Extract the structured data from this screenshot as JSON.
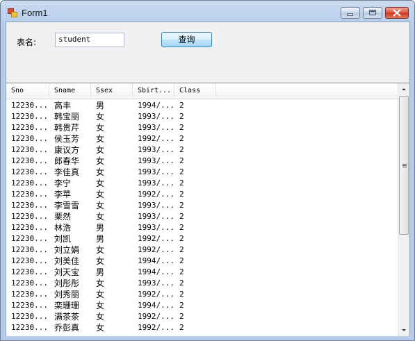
{
  "window": {
    "title": "Form1"
  },
  "form": {
    "table_label": "表名:",
    "table_input_value": "student",
    "query_button": "查询"
  },
  "grid": {
    "columns": [
      "Sno",
      "Sname",
      "Ssex",
      "Sbirt...",
      "Class"
    ],
    "rows": [
      [
        "12230...",
        "高丰",
        "男",
        "1994/...",
        "2"
      ],
      [
        "12230...",
        "韩宝丽",
        "女",
        "1993/...",
        "2"
      ],
      [
        "12230...",
        "韩贵芹",
        "女",
        "1993/...",
        "2"
      ],
      [
        "12230...",
        "侯玉芳",
        "女",
        "1992/...",
        "2"
      ],
      [
        "12230...",
        "康议方",
        "女",
        "1993/...",
        "2"
      ],
      [
        "12230...",
        "郎春华",
        "女",
        "1993/...",
        "2"
      ],
      [
        "12230...",
        "李佳真",
        "女",
        "1993/...",
        "2"
      ],
      [
        "12230...",
        "李宁",
        "女",
        "1993/...",
        "2"
      ],
      [
        "12230...",
        "李苹",
        "女",
        "1992/...",
        "2"
      ],
      [
        "12230...",
        "李雪雪",
        "女",
        "1993/...",
        "2"
      ],
      [
        "12230...",
        "栗然",
        "女",
        "1993/...",
        "2"
      ],
      [
        "12230...",
        "林浩",
        "男",
        "1993/...",
        "2"
      ],
      [
        "12230...",
        "刘凯",
        "男",
        "1992/...",
        "2"
      ],
      [
        "12230...",
        "刘立娟",
        "女",
        "1992/...",
        "2"
      ],
      [
        "12230...",
        "刘美佳",
        "女",
        "1994/...",
        "2"
      ],
      [
        "12230...",
        "刘天宝",
        "男",
        "1994/...",
        "2"
      ],
      [
        "12230...",
        "刘彤彤",
        "女",
        "1993/...",
        "2"
      ],
      [
        "12230...",
        "刘秀丽",
        "女",
        "1992/...",
        "2"
      ],
      [
        "12230...",
        "栾珊珊",
        "女",
        "1994/...",
        "2"
      ],
      [
        "12230...",
        "满茶茶",
        "女",
        "1992/...",
        "2"
      ],
      [
        "12230...",
        "乔彭真",
        "女",
        "1992/...",
        "2"
      ]
    ]
  },
  "icons": {
    "app": "form-app-icon",
    "minimize": "minimize-icon",
    "maximize": "maximize-icon",
    "close": "close-icon",
    "scroll_up": "scroll-up-arrow-icon",
    "scroll_down": "scroll-down-arrow-icon"
  },
  "colors": {
    "close_button": "#c7361c",
    "button_border": "#3c7fb1"
  }
}
